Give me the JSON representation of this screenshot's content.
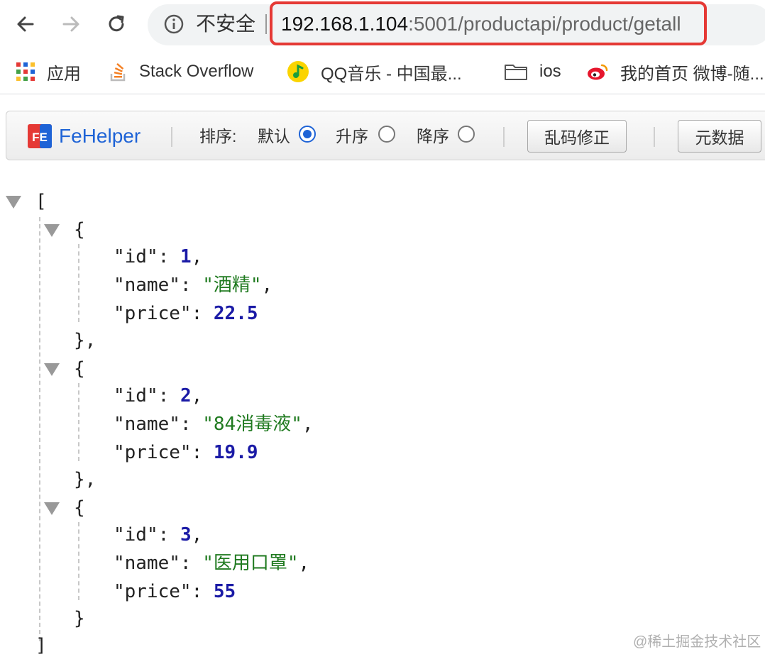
{
  "browser": {
    "security_label": "不安全",
    "url_host": "192.168.1.104",
    "url_path": ":5001/productapi/product/getall"
  },
  "bookmarks": [
    {
      "label": "应用",
      "icon": "apps-grid-icon"
    },
    {
      "label": "Stack Overflow",
      "icon": "stackoverflow-icon"
    },
    {
      "label": "QQ音乐 - 中国最...",
      "icon": "qq-music-icon"
    },
    {
      "label": "ios",
      "icon": "folder-icon"
    },
    {
      "label": "我的首页 微博-随...",
      "icon": "weibo-icon"
    }
  ],
  "fehelper": {
    "brand": "FeHelper",
    "logo_text": "FE",
    "sort_label": "排序:",
    "sort_options": [
      {
        "label": "默认",
        "selected": true
      },
      {
        "label": "升序",
        "selected": false
      },
      {
        "label": "降序",
        "selected": false
      }
    ],
    "fix_encoding_button": "乱码修正",
    "metadata_button": "元数据"
  },
  "json": {
    "open_bracket": "[",
    "close_bracket": "]",
    "items": [
      {
        "id": "1",
        "name": "\"酒精\"",
        "price": "22.5",
        "trailing": ","
      },
      {
        "id": "2",
        "name": "\"84消毒液\"",
        "price": "19.9",
        "trailing": ","
      },
      {
        "id": "3",
        "name": "\"医用口罩\"",
        "price": "55",
        "trailing": ""
      }
    ],
    "keys": {
      "id": "\"id\"",
      "name": "\"name\"",
      "price": "\"price\""
    }
  },
  "watermark": "@稀土掘金技术社区",
  "colors": {
    "accent": "#1e63d6",
    "highlight": "#e53935",
    "number": "#1a1aa6",
    "string": "#1f7a1f"
  }
}
